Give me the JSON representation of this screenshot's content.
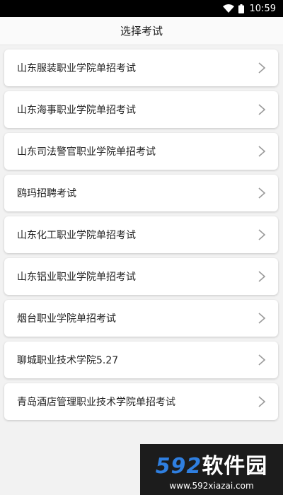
{
  "status_bar": {
    "time": "10:59"
  },
  "header": {
    "title": "选择考试"
  },
  "exams": [
    {
      "label": "山东服装职业学院单招考试"
    },
    {
      "label": "山东海事职业学院单招考试"
    },
    {
      "label": "山东司法警官职业学院单招考试"
    },
    {
      "label": "鸥玛招聘考试"
    },
    {
      "label": "山东化工职业学院单招考试"
    },
    {
      "label": "山东铝业职业学院单招考试"
    },
    {
      "label": "烟台职业学院单招考试"
    },
    {
      "label": "聊城职业技术学院5.27"
    },
    {
      "label": "青岛酒店管理职业技术学院单招考试"
    }
  ],
  "watermark": {
    "logo_num": "592",
    "logo_text": "软件园",
    "url": "www.592xiazai.com"
  }
}
